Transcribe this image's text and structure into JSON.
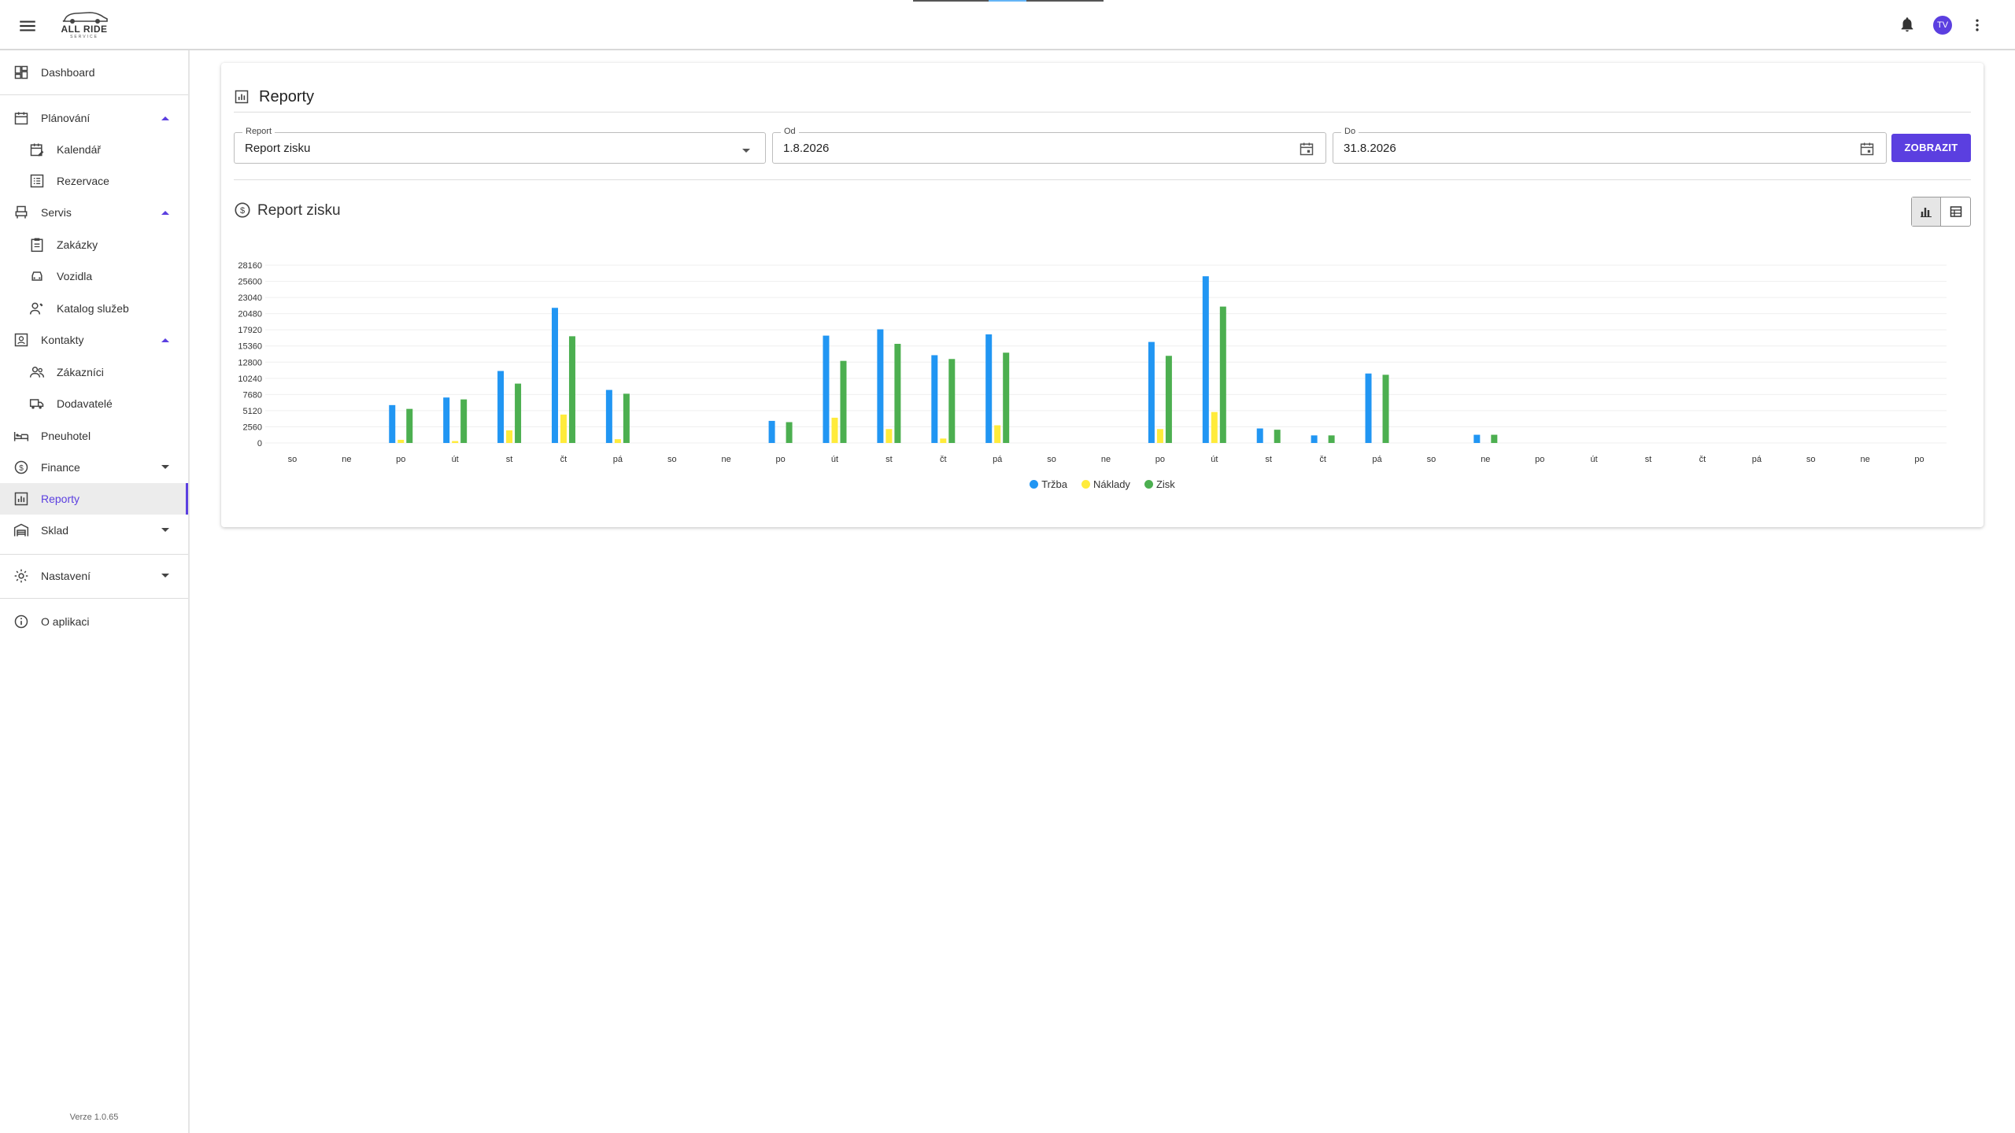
{
  "app": {
    "logo_text": "ALL RIDE",
    "logo_sub": "SERVICE",
    "user_initials": "TV"
  },
  "sidebar": {
    "dashboard": "Dashboard",
    "planovani": "Plánování",
    "kalendar": "Kalendář",
    "rezervace": "Rezervace",
    "servis": "Servis",
    "zakazky": "Zakázky",
    "vozidla": "Vozidla",
    "katalog": "Katalog služeb",
    "kontakty": "Kontakty",
    "zakaznici": "Zákazníci",
    "dodavatele": "Dodavatelé",
    "pneuhotel": "Pneuhotel",
    "finance": "Finance",
    "reporty": "Reporty",
    "sklad": "Sklad",
    "nastaveni": "Nastavení",
    "o_aplikaci": "O aplikaci",
    "version": "Verze 1.0.65"
  },
  "page": {
    "title": "Reporty",
    "report_label": "Report",
    "report_value": "Report zisku",
    "od_label": "Od",
    "od_value": "1.8.2026",
    "do_label": "Do",
    "do_value": "31.8.2026",
    "show_button": "ZOBRAZIT",
    "report_title": "Report zisku"
  },
  "colors": {
    "accent": "#5b3fe0",
    "trzba": "#2196f3",
    "naklady": "#ffeb3b",
    "zisk": "#4caf50"
  },
  "chart_data": {
    "type": "bar",
    "categories": [
      "so",
      "ne",
      "po",
      "út",
      "st",
      "čt",
      "pá",
      "so",
      "ne",
      "po",
      "út",
      "st",
      "čt",
      "pá",
      "so",
      "ne",
      "po",
      "út",
      "st",
      "čt",
      "pá",
      "so",
      "ne",
      "po",
      "út",
      "st",
      "čt",
      "pá",
      "so",
      "ne",
      "po"
    ],
    "yticks": [
      0,
      2560,
      5120,
      7680,
      10240,
      12800,
      15360,
      17920,
      20480,
      23040,
      25600,
      28160
    ],
    "ylim": [
      0,
      28160
    ],
    "grid": true,
    "legend_position": "bottom",
    "series": [
      {
        "name": "Tržba",
        "color": "#2196f3",
        "values": [
          0,
          0,
          6000,
          7200,
          11400,
          21400,
          8400,
          0,
          0,
          3500,
          17000,
          18000,
          13900,
          17200,
          0,
          0,
          16000,
          26400,
          2300,
          1200,
          11000,
          0,
          1300,
          0,
          0,
          0,
          0,
          0,
          0,
          0,
          0
        ]
      },
      {
        "name": "Náklady",
        "color": "#ffeb3b",
        "values": [
          0,
          0,
          500,
          300,
          2000,
          4500,
          600,
          0,
          0,
          0,
          4000,
          2200,
          700,
          2800,
          0,
          0,
          2200,
          4900,
          0,
          0,
          0,
          0,
          0,
          0,
          0,
          0,
          0,
          0,
          0,
          0,
          0
        ]
      },
      {
        "name": "Zisk",
        "color": "#4caf50",
        "values": [
          0,
          0,
          5400,
          6900,
          9400,
          16900,
          7800,
          0,
          0,
          3300,
          13000,
          15700,
          13300,
          14300,
          0,
          0,
          13800,
          21600,
          2100,
          1200,
          10800,
          0,
          1300,
          0,
          0,
          0,
          0,
          0,
          0,
          0,
          0
        ]
      }
    ]
  }
}
